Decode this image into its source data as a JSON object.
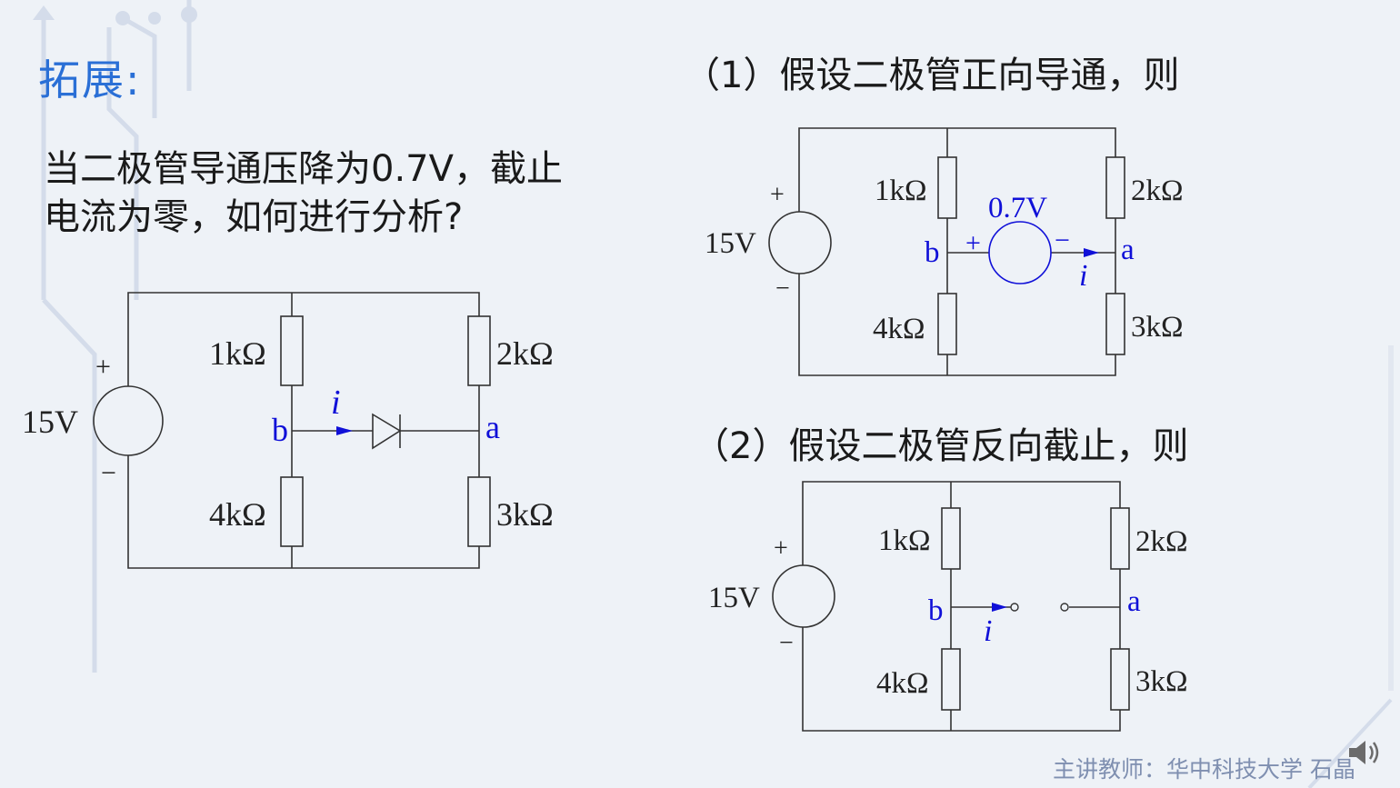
{
  "slide": {
    "title": "拓展:",
    "question_lines": [
      "当二极管导通压降为0.7V，截止",
      "电流为零，如何进行分析?"
    ],
    "footer": "主讲教师：华中科技大学 石晶"
  },
  "case1": {
    "heading": "（1）假设二极管正向导通，则"
  },
  "case2": {
    "heading": "（2）假设二极管反向截止，则"
  },
  "circuit_main": {
    "source_label": "15V",
    "plus": "+",
    "minus": "−",
    "r1": "1kΩ",
    "r2": "2kΩ",
    "r3": "3kΩ",
    "r4": "4kΩ",
    "node_b": "b",
    "node_a": "a",
    "current": "i"
  },
  "circuit_forward": {
    "source_label": "15V",
    "plus": "+",
    "minus": "−",
    "r1": "1kΩ",
    "r2": "2kΩ",
    "r3": "3kΩ",
    "r4": "4kΩ",
    "node_b": "b",
    "node_a": "a",
    "current": "i",
    "vsrc_label": "0.7V",
    "vsrc_plus": "+",
    "vsrc_minus": "−"
  },
  "circuit_reverse": {
    "source_label": "15V",
    "plus": "+",
    "minus": "−",
    "r1": "1kΩ",
    "r2": "2kΩ",
    "r3": "3kΩ",
    "r4": "4kΩ",
    "node_b": "b",
    "node_a": "a",
    "current": "i"
  },
  "colors": {
    "title": "#2a6fd6",
    "annotation": "#1010d8",
    "wire": "#333333",
    "footer": "#7f8fb0"
  },
  "icons": {
    "speaker": "speaker-icon"
  }
}
